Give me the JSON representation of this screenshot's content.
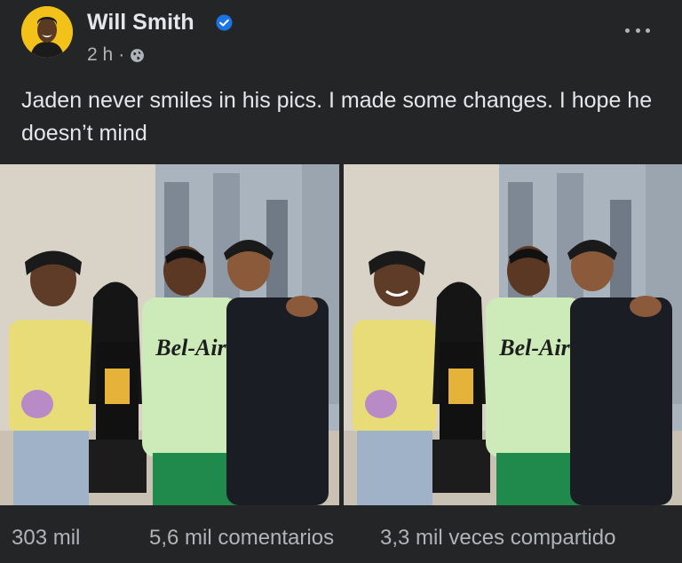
{
  "post": {
    "author": "Will Smith",
    "time": "2 h",
    "separator": "·",
    "text": "Jaden never smiles in his pics.  I made some changes.  I hope he doesn’t mind",
    "graphic_text": "Bel-Air"
  },
  "stats": {
    "reactions": "303 mil",
    "comments": "5,6 mil comentarios",
    "shares": "3,3 mil veces compartido"
  },
  "icons": {
    "verified": "verified-badge-icon",
    "audience": "globe-icon",
    "more": "more-options-icon"
  },
  "colors": {
    "background": "#242526",
    "text_primary": "#e4e6eb",
    "text_secondary": "#b0b3b8",
    "verified_blue": "#1b74e4",
    "avatar_bg": "#f2c21a"
  }
}
